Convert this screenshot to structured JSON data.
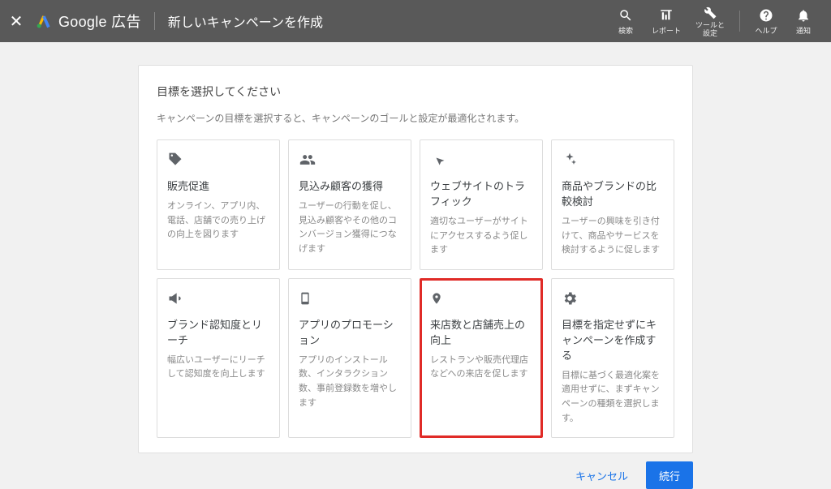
{
  "header": {
    "product_name": "Google 広告",
    "page_title": "新しいキャンペーンを作成",
    "icons": {
      "search": "検索",
      "report": "レポート",
      "tools": "ツールと\n設定",
      "help": "ヘルプ",
      "notifications": "通知"
    }
  },
  "main": {
    "title": "目標を選択してください",
    "subtitle": "キャンペーンの目標を選択すると、キャンペーンのゴールと設定が最適化されます。"
  },
  "cards": [
    {
      "title": "販売促進",
      "desc": "オンライン、アプリ内、電話、店舗での売り上げの向上を図ります"
    },
    {
      "title": "見込み顧客の獲得",
      "desc": "ユーザーの行動を促し、見込み顧客やその他のコンバージョン獲得につなげます"
    },
    {
      "title": "ウェブサイトのトラフィック",
      "desc": "適切なユーザーがサイトにアクセスするよう促します"
    },
    {
      "title": "商品やブランドの比較検討",
      "desc": "ユーザーの興味を引き付けて、商品やサービスを検討するように促します"
    },
    {
      "title": "ブランド認知度とリーチ",
      "desc": "幅広いユーザーにリーチして認知度を向上します"
    },
    {
      "title": "アプリのプロモーション",
      "desc": "アプリのインストール数、インタラクション数、事前登録数を増やします"
    },
    {
      "title": "来店数と店舗売上の向上",
      "desc": "レストランや販売代理店などへの来店を促します"
    },
    {
      "title": "目標を指定せずにキャンペーンを作成する",
      "desc": "目標に基づく最適化案を適用せずに、まずキャンペーンの種類を選択します。"
    }
  ],
  "actions": {
    "cancel": "キャンセル",
    "continue": "続行"
  }
}
